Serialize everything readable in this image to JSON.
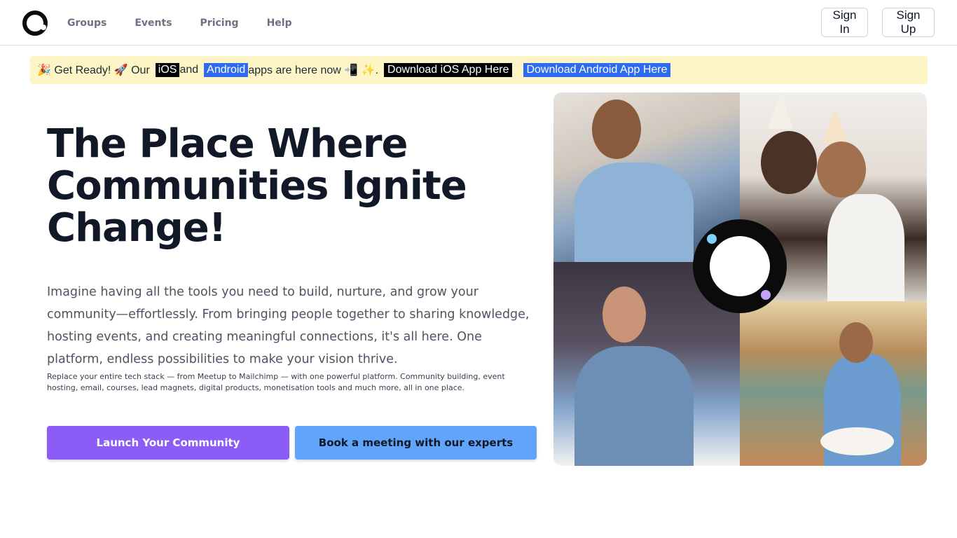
{
  "header": {
    "nav": [
      "Groups",
      "Events",
      "Pricing",
      "Help"
    ],
    "sign_in": "Sign In",
    "sign_up": "Sign Up"
  },
  "banner": {
    "prefix": "🎉 Get Ready! 🚀 Our",
    "ios": "iOS",
    "and": "and",
    "android": "Android",
    "suffix": "apps are here now 📲 ✨.",
    "download_ios": "Download iOS App Here",
    "download_android": "Download Android App Here"
  },
  "hero": {
    "title": "The Place Where Communities Ignite Change!",
    "description": "Imagine having all the tools you need to build, nurture, and grow your community—effortlessly. From bringing people together to sharing knowledge, hosting events, and creating meaningful connections, it's all here. One platform, endless possibilities to make your vision thrive.",
    "small_text": "Replace your entire tech stack — from Meetup to Mailchimp — with one powerful platform. Community building, event hosting, email, courses, lead magnets, digital products, monetisation tools and much more, all in one place.",
    "primary_button": "Launch Your Community",
    "secondary_button": "Book a meeting with our experts"
  },
  "colors": {
    "primary": "#8b5cf6",
    "secondary": "#60a5fa",
    "banner_bg": "#fdf5c6",
    "android_tag": "#2d6bf0"
  }
}
